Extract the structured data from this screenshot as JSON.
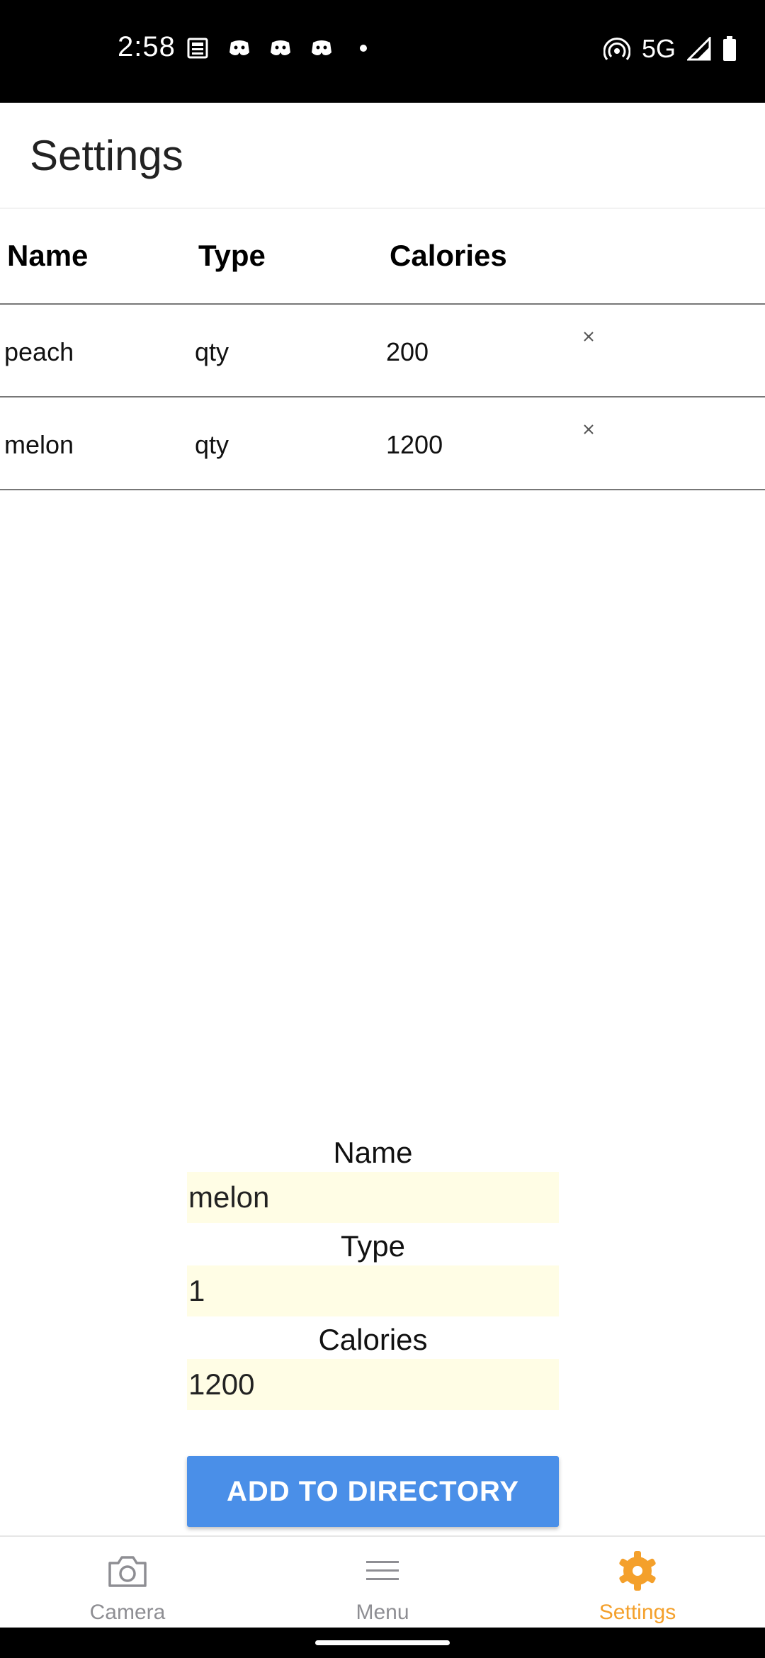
{
  "status_bar": {
    "time": "2:58",
    "network": "5G",
    "notification_icons": [
      "news-icon",
      "discord-icon",
      "discord-icon",
      "discord-icon"
    ],
    "right_icons": [
      "hotspot-icon",
      "signal-icon",
      "battery-icon"
    ]
  },
  "header": {
    "title": "Settings"
  },
  "table": {
    "columns": [
      "Name",
      "Type",
      "Calories"
    ],
    "rows": [
      {
        "name": "peach",
        "type": "qty",
        "calories": "200",
        "delete_symbol": "×"
      },
      {
        "name": "melon",
        "type": "qty",
        "calories": "1200",
        "delete_symbol": "×"
      }
    ]
  },
  "form": {
    "name_label": "Name",
    "name_value": "melon",
    "type_label": "Type",
    "type_value": "1",
    "calories_label": "Calories",
    "calories_value": "1200",
    "submit_label": "ADD TO DIRECTORY"
  },
  "tabs": [
    {
      "label": "Camera",
      "icon": "camera-icon",
      "active": false
    },
    {
      "label": "Menu",
      "icon": "menu-icon",
      "active": false
    },
    {
      "label": "Settings",
      "icon": "gear-icon",
      "active": true
    }
  ],
  "colors": {
    "accent": "#f4a02b",
    "button": "#4a8fe8",
    "input_bg": "#fffde5",
    "inactive_tab": "#8e8e93"
  }
}
